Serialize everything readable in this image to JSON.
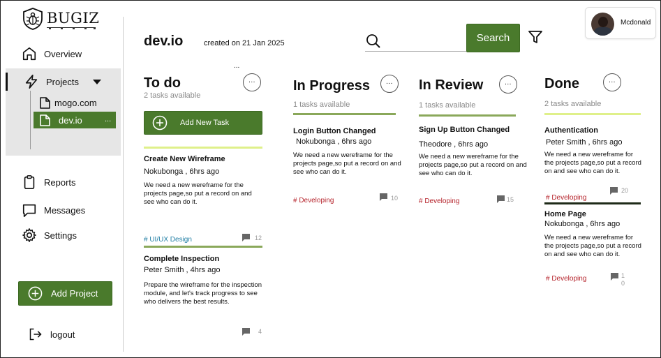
{
  "brand": {
    "name": "BUGIZ"
  },
  "sidebar": {
    "overview": "Overview",
    "projects": "Projects",
    "project_items": [
      "mogo.com",
      "dev.io"
    ],
    "active_more": "...",
    "reports": "Reports",
    "messages": "Messages",
    "settings": "Settings",
    "add_project": "Add Project",
    "logout": "logout"
  },
  "header": {
    "project_name": "dev.io",
    "created": "created on 21 Jan 2025",
    "search_label": "Search",
    "user_name": "Mcdonald"
  },
  "colors": {
    "primary_green": "#4a7a2c",
    "todo_bar": "#dff08a",
    "progress_bar": "#8aa85a",
    "tag_red": "#b5222a",
    "tag_blue": "#1f7da3"
  },
  "board": {
    "more_glyph": "...",
    "columns": [
      {
        "title": "To do",
        "subtitle": "2 tasks available",
        "add_task": "Add New Task"
      },
      {
        "title": "In Progress",
        "subtitle": "1 tasks available"
      },
      {
        "title": "In Review",
        "subtitle": "1 tasks available"
      },
      {
        "title": "Done",
        "subtitle": "2 tasks available"
      }
    ],
    "cards": [
      {
        "title": "Create New Wireframe",
        "meta": "Nokubonga , 6hrs ago",
        "desc": "We need a new wereframe for the projects page,so put a record on and see who can do it.",
        "tag": "# UI/UX Design",
        "count": "12"
      },
      {
        "title": "Complete Inspection",
        "meta": "Peter Smith , 4hrs ago",
        "desc": "Prepare the wireframe for the inspection module, and let's track progress to see who delivers the best results.",
        "count": "4"
      },
      {
        "title": "Login Button Changed",
        "meta": "Nokubonga , 6hrs ago",
        "desc": "We need a new wereframe for the projects page,so put a record on and see who can do it.",
        "tag": "# Developing",
        "count": "10"
      },
      {
        "title": "Sign Up Button Changed",
        "meta": "Theodore , 6hrs ago",
        "desc": "We need a new wereframe for the projects page,so put a record on and see who can do it.",
        "tag": "# Developing",
        "count": "15"
      },
      {
        "title": "Authentication",
        "meta": "Peter Smith , 6hrs ago",
        "desc": "We need a new wereframe for the projects page,so put a record on and see who can do it.",
        "tag": "# Developing",
        "count": "20"
      },
      {
        "title": "Home Page",
        "meta": "Nokubonga , 6hrs ago",
        "desc": "We need a new wereframe for the projects page,so put a record on and see who can do it.",
        "tag": "# Developing",
        "count_lines": [
          "1",
          "0"
        ]
      }
    ]
  }
}
